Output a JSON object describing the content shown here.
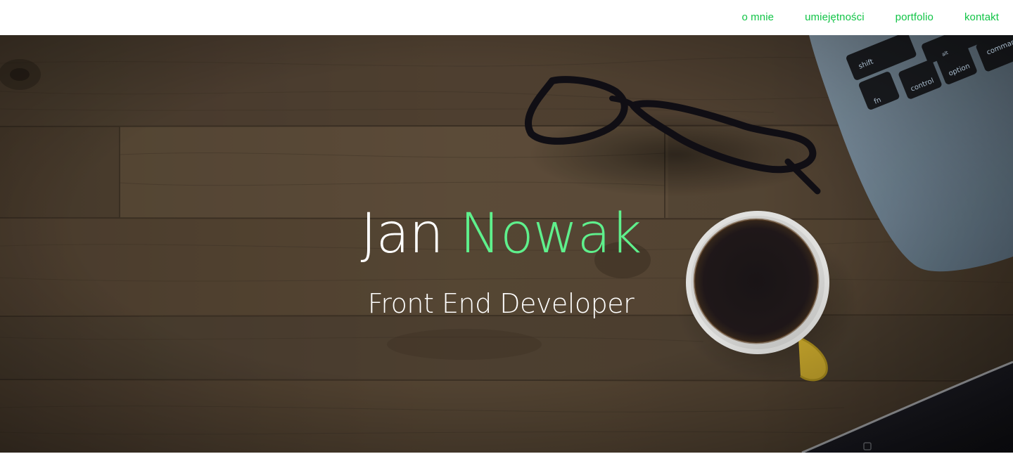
{
  "nav": {
    "items": [
      {
        "label": "o mnie"
      },
      {
        "label": "umiejętności"
      },
      {
        "label": "portfolio"
      },
      {
        "label": "kontakt"
      }
    ]
  },
  "hero": {
    "first_name": "Jan",
    "last_name": "Nowak",
    "role": "Front End Developer",
    "background": "wooden desk with glasses, coffee cup and laptop"
  },
  "keyboard": {
    "keys": [
      "shift",
      "fn",
      "control",
      "alt",
      "option",
      "command"
    ]
  },
  "colors": {
    "accent": "#12c447",
    "name_accent": "#5ff08c",
    "navbar": "#ffffff",
    "wood": "#564736"
  }
}
